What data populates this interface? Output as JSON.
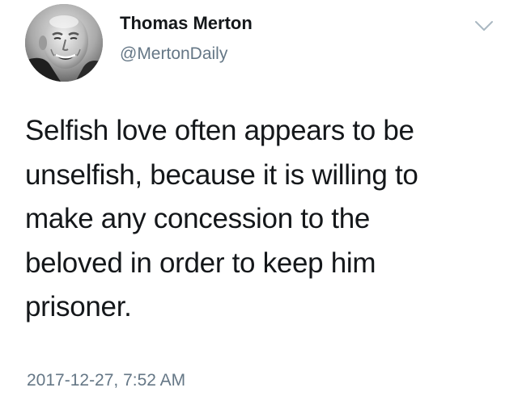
{
  "tweet": {
    "author": {
      "display_name": "Thomas Merton",
      "handle": "@MertonDaily",
      "avatar_icon": "profile-photo"
    },
    "menu_icon": "chevron-down-icon",
    "text": "Selfish love often appears to be\nunselfish, because it is willing to\nmake any concession to the\nbeloved in order to keep him\nprisoner.",
    "timestamp": "2017-12-27, 7:52 AM"
  },
  "colors": {
    "primary_text": "#14171a",
    "secondary_text": "#657786",
    "chevron": "#aab8c2",
    "background": "#ffffff"
  }
}
